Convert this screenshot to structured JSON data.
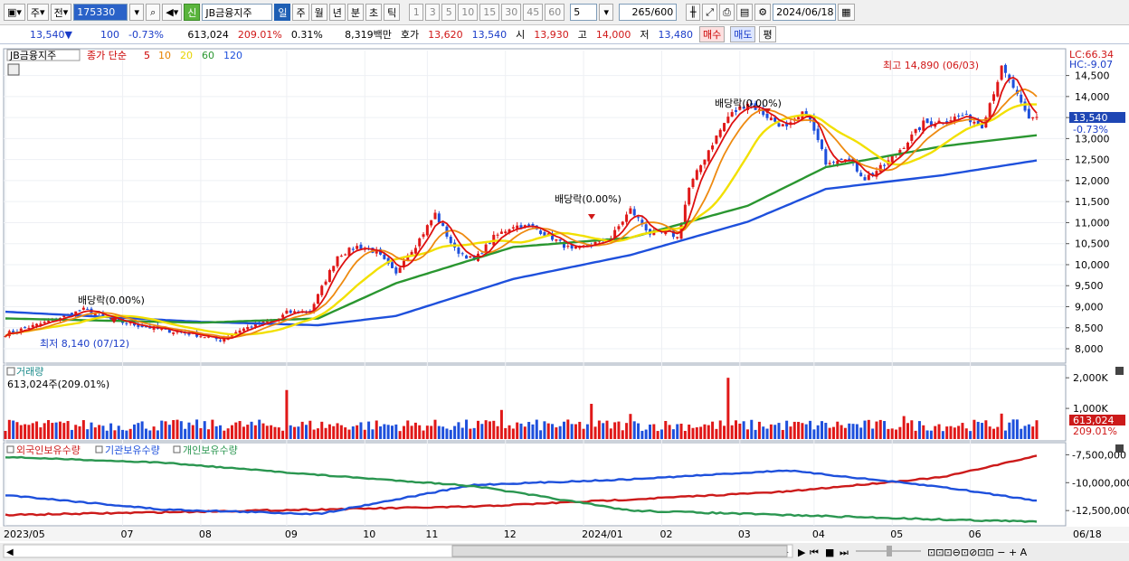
{
  "toolbar": {
    "market": "주",
    "prev": "전",
    "code": "175330",
    "tags": {
      "sin": "신",
      "name": "JB금융지주"
    },
    "periods": [
      "일",
      "주",
      "월",
      "년",
      "분",
      "초",
      "틱"
    ],
    "active_period": "일",
    "multiples": [
      "1",
      "3",
      "5",
      "10",
      "15",
      "30",
      "45",
      "60"
    ],
    "multiplier_value": "5",
    "count": "265",
    "count_max": "/600",
    "date": "2024/06/18"
  },
  "quote": {
    "price": "13,540▼",
    "change": "100",
    "change_pct": "-0.73%",
    "volume": "613,024",
    "volume_ratio": "209.01%",
    "turnover_pct": "0.31%",
    "amount": "8,319백만",
    "bid_label": "호가",
    "ask_price": "13,620",
    "bid_price": "13,540",
    "open_label": "시",
    "open": "13,930",
    "high_label": "고",
    "high": "14,000",
    "low_label": "저",
    "low": "13,480",
    "buy_label": "매수",
    "sell_label": "매도",
    "eval_label": "평"
  },
  "price_panel": {
    "legend_name": "JB금융지주",
    "legend_items": [
      "종가 단순",
      "5",
      "10",
      "20",
      "60",
      "120"
    ],
    "legend_colors": [
      "#cc0000",
      "#cc0000",
      "#e68200",
      "#e6d200",
      "#2a9630",
      "#1e50dc"
    ],
    "lc": "LC:66.34",
    "hc": "HC:-9.07",
    "y_ticks": [
      "14,500",
      "14,000",
      "13,500",
      "13,000",
      "12,500",
      "12,000",
      "11,500",
      "11,000",
      "10,500",
      "10,000",
      "9,500",
      "9,000",
      "8,500",
      "8,000"
    ],
    "current_price": "13,540",
    "current_change": "-0.73%",
    "annotations": {
      "high": "최고 14,890 (06/03)",
      "low": "최저 8,140 (07/12)",
      "div1": "배당락(0.00%)",
      "div2": "배당락(0.00%)",
      "div3": "배당락(0.00%)"
    }
  },
  "volume_panel": {
    "title": "거래량",
    "value": "613,024주(209.01%)",
    "y_ticks": [
      "2,000K",
      "1,000K"
    ],
    "current": "613,024",
    "current_pct": "209.01%"
  },
  "holdings_panel": {
    "series": [
      "외국인보유수량",
      "기관보유수량",
      "개인보유수량"
    ],
    "colors": [
      "#cc1a1a",
      "#1e50dc",
      "#2a9650"
    ],
    "y_ticks": [
      "-7,500,000",
      "-10,000,000",
      "-12,500,000"
    ]
  },
  "x_axis": {
    "labels": [
      "2023/05",
      "07",
      "08",
      "09",
      "10",
      "11",
      "12",
      "2024/01",
      "02",
      "03",
      "04",
      "05",
      "06"
    ],
    "end_label": "06/18"
  },
  "chart_data": {
    "type": "candlestick",
    "ylim": [
      7700,
      15050
    ],
    "price_anchors": {
      "days": [
        0,
        10,
        20,
        28,
        40,
        48,
        55,
        60,
        70,
        72,
        78,
        85,
        90,
        95,
        100,
        102,
        105,
        110,
        115,
        120,
        125,
        130,
        135,
        140,
        145,
        150,
        155,
        160,
        165,
        170,
        172,
        175,
        180,
        185,
        190,
        195,
        200,
        205,
        210,
        215,
        220,
        225,
        230,
        235,
        240,
        245,
        250,
        255,
        258,
        260,
        262,
        264
      ],
      "close": [
        8350,
        8620,
        8930,
        8660,
        8450,
        8350,
        8210,
        8450,
        8720,
        8860,
        8890,
        10210,
        10430,
        10300,
        9760,
        10150,
        10460,
        11210,
        10360,
        10100,
        10650,
        10930,
        10890,
        10640,
        10340,
        10480,
        10640,
        11310,
        10740,
        10760,
        10640,
        11820,
        12730,
        13520,
        13860,
        13530,
        13240,
        13650,
        12450,
        12580,
        12050,
        12360,
        12840,
        13360,
        13420,
        13550,
        13320,
        14660,
        14220,
        13780,
        13450,
        13540
      ]
    },
    "ma_anchors": {
      "days": [
        0,
        50,
        80,
        100,
        130,
        160,
        190,
        210,
        240,
        264
      ],
      "ma60": [
        8720,
        8620,
        8720,
        9560,
        10420,
        10640,
        11400,
        12320,
        12820,
        13080
      ],
      "ma120": [
        8880,
        8640,
        8560,
        8780,
        9660,
        10230,
        11020,
        11800,
        12130,
        12480
      ]
    },
    "volume_k": [],
    "holdings_anchors": {
      "days": [
        0,
        40,
        80,
        120,
        160,
        200,
        240,
        264
      ],
      "foreign": [
        -12900000,
        -12650000,
        -12400000,
        -12150000,
        -11500000,
        -10800000,
        -9500000,
        -7600000
      ],
      "institution": [
        -11100000,
        -12400000,
        -12800000,
        -10200000,
        -9700000,
        -8900000,
        -10400000,
        -11600000
      ],
      "individual": [
        -7700000,
        -8200000,
        -9300000,
        -10300000,
        -12500000,
        -12900000,
        -13300000,
        -13500000
      ]
    },
    "holdings_ylim": [
      -13700000,
      -6900000
    ],
    "volume_ylim_k": [
      0,
      2300
    ]
  }
}
